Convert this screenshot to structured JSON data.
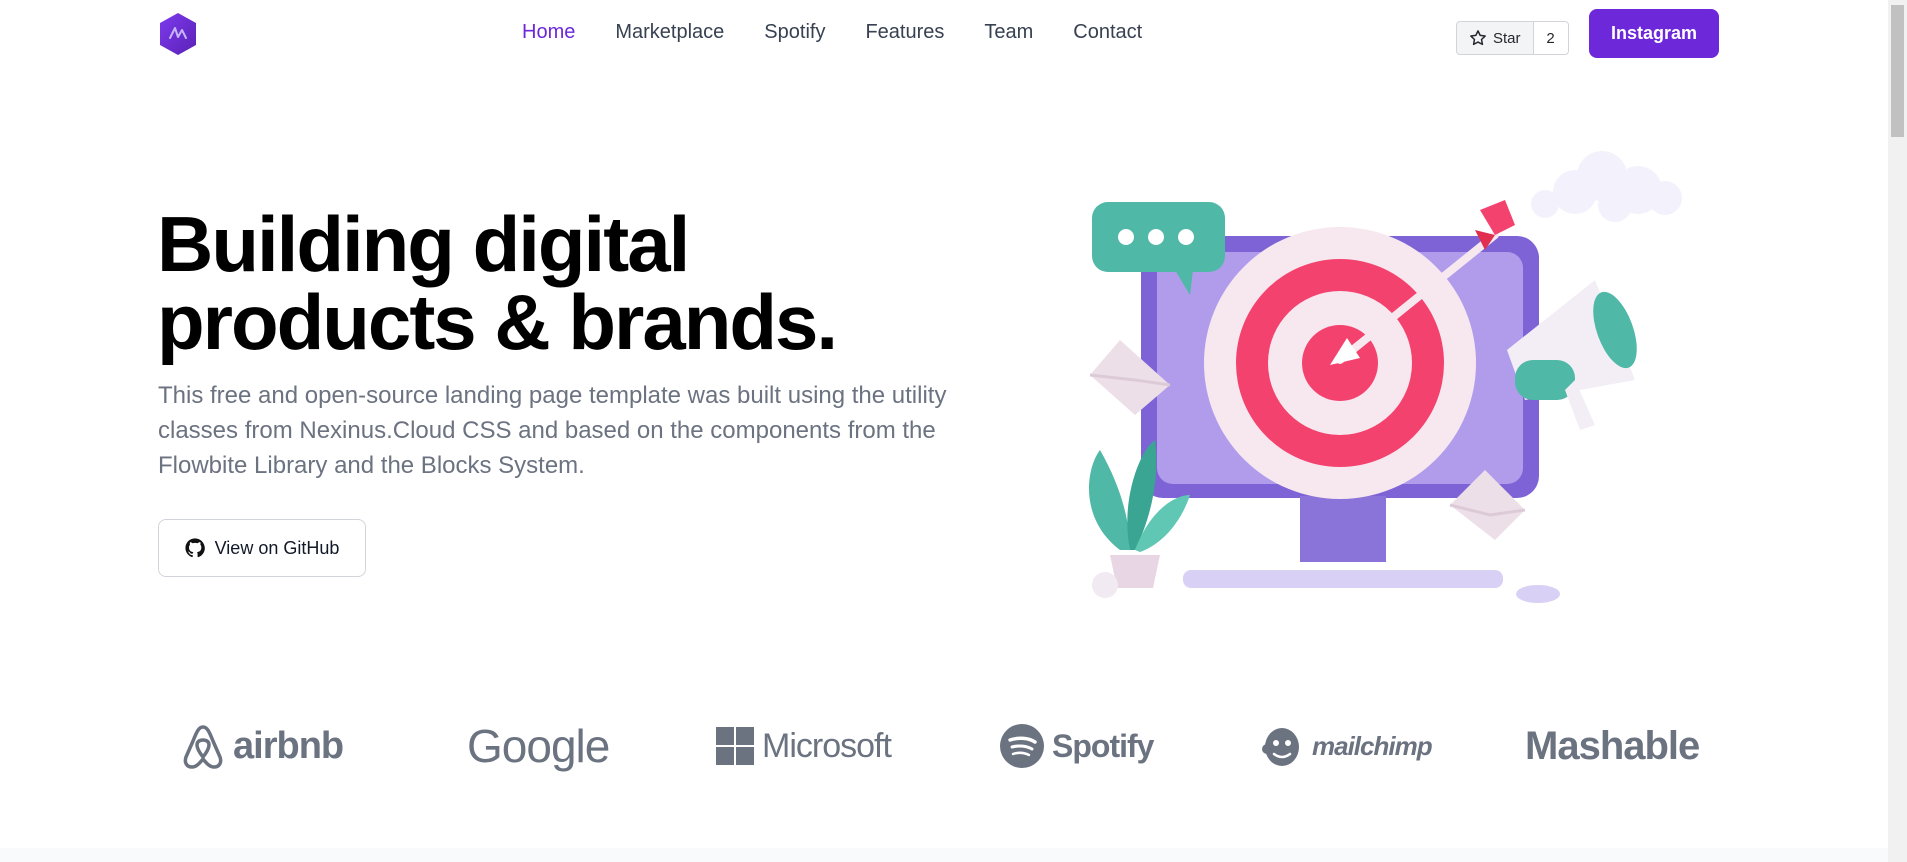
{
  "header": {
    "nav": [
      "Home",
      "Marketplace",
      "Spotify",
      "Features",
      "Team",
      "Contact"
    ],
    "active_nav": "Home",
    "star_label": "Star",
    "star_count": "2",
    "cta_label": "Instagram"
  },
  "hero": {
    "title_line1": "Building digital",
    "title_line2": "products & brands.",
    "description": "This free and open-source landing page template was built using the utility classes from Nexinus.Cloud CSS and based on the components from the Flowbite Library and the Blocks System.",
    "github_button": "View on GitHub"
  },
  "brands": [
    "airbnb",
    "Google",
    "Microsoft",
    "Spotify",
    "mailchimp",
    "Mashable"
  ],
  "colors": {
    "accent": "#6d28d9",
    "text_dark": "#111827",
    "text_muted": "#6b7280",
    "brand_gray": "#6b7280"
  }
}
